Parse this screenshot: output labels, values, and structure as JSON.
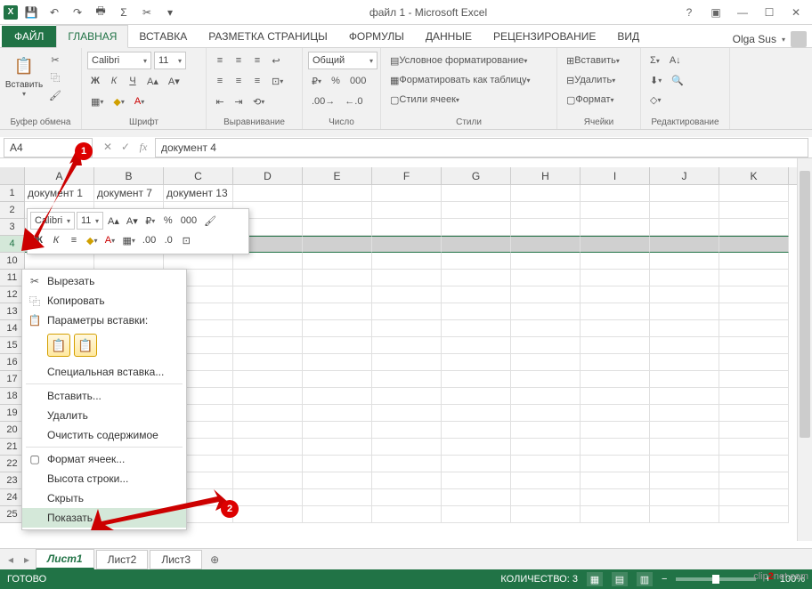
{
  "title": "файл 1 - Microsoft Excel",
  "user": "Olga Sus",
  "tabs": {
    "file": "ФАЙЛ",
    "items": [
      "ГЛАВНАЯ",
      "ВСТАВКА",
      "РАЗМЕТКА СТРАНИЦЫ",
      "ФОРМУЛЫ",
      "ДАННЫЕ",
      "РЕЦЕНЗИРОВАНИЕ",
      "ВИД"
    ],
    "active": 0
  },
  "ribbon": {
    "clipboard": {
      "label": "Буфер обмена",
      "paste": "Вставить"
    },
    "font": {
      "label": "Шрифт",
      "name": "Calibri",
      "size": "11"
    },
    "align": {
      "label": "Выравнивание"
    },
    "number": {
      "label": "Число",
      "format": "Общий"
    },
    "styles": {
      "label": "Стили",
      "cond": "Условное форматирование",
      "table": "Форматировать как таблицу",
      "cell": "Стили ячеек"
    },
    "cells": {
      "label": "Ячейки",
      "insert": "Вставить",
      "delete": "Удалить",
      "format": "Формат"
    },
    "editing": {
      "label": "Редактирование"
    }
  },
  "namebox": "A4",
  "formula": "документ 4",
  "columns": [
    "A",
    "B",
    "C",
    "D",
    "E",
    "F",
    "G",
    "H",
    "I",
    "J",
    "K"
  ],
  "rows_visible": [
    1,
    2,
    3,
    4,
    10,
    11,
    12,
    13,
    14,
    15,
    16,
    17,
    18,
    19,
    20,
    21,
    22,
    23,
    24,
    25
  ],
  "row1": [
    "документ 1",
    "документ 7",
    "документ 13"
  ],
  "mini": {
    "font": "Calibri",
    "size": "11"
  },
  "context": {
    "cut": "Вырезать",
    "copy": "Копировать",
    "paste_header": "Параметры вставки:",
    "paste_special": "Специальная вставка...",
    "insert": "Вставить...",
    "delete": "Удалить",
    "clear": "Очистить содержимое",
    "format_cells": "Формат ячеек...",
    "row_height": "Высота строки...",
    "hide": "Скрыть",
    "show": "Показать"
  },
  "sheets": [
    "Лист1",
    "Лист2",
    "Лист3"
  ],
  "active_sheet": 0,
  "status": {
    "ready": "ГОТОВО",
    "count_label": "КОЛИЧЕСТВО:",
    "count": "3",
    "zoom": "100%"
  },
  "callouts": {
    "1": "1",
    "2": "2"
  },
  "watermark": {
    "a": "clip",
    "b": "2",
    "c": "net.com"
  }
}
